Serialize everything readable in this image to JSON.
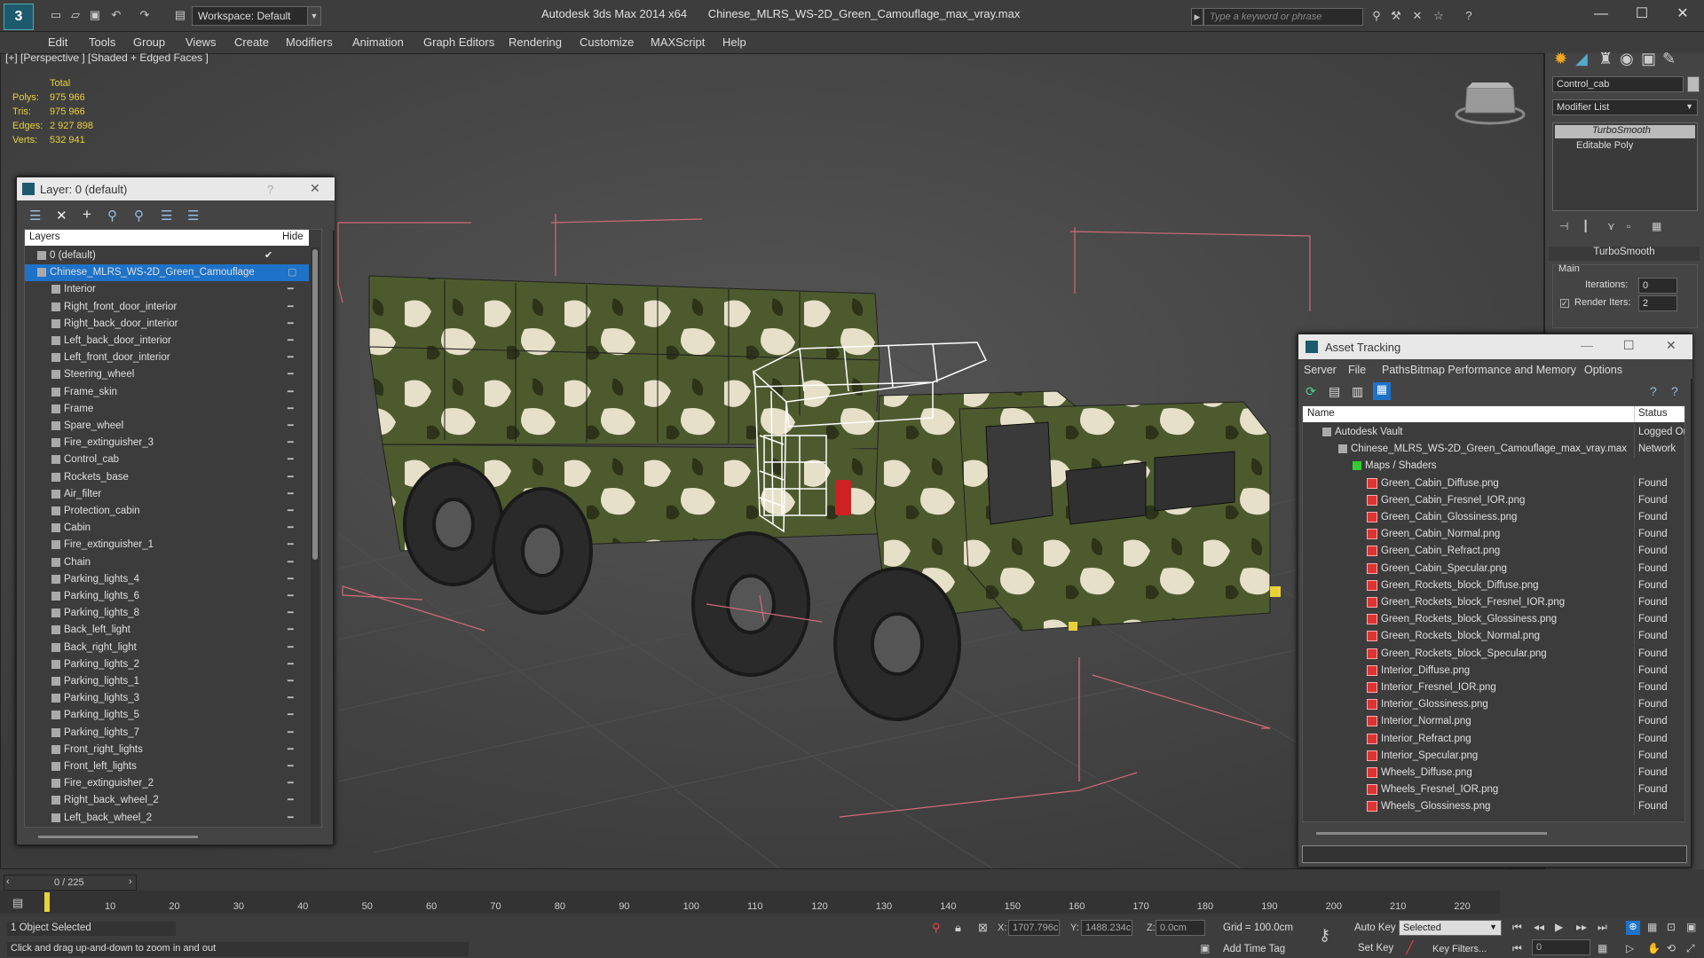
{
  "window": {
    "app_title": "Autodesk 3ds Max  2014 x64",
    "file_title": "Chinese_MLRS_WS-2D_Green_Camouflage_max_vray.max",
    "workspace": "Workspace: Default",
    "search_placeholder": "Type a keyword or phrase"
  },
  "menu": [
    "Edit",
    "Tools",
    "Group",
    "Views",
    "Create",
    "Modifiers",
    "Animation",
    "Graph Editors",
    "Rendering",
    "Customize",
    "MAXScript",
    "Help"
  ],
  "viewport": {
    "label": "[+] [Perspective ] [Shaded + Edged Faces ]",
    "stats": {
      "header": "Total",
      "polys_label": "Polys:",
      "polys": "975 966",
      "tris_label": "Tris:",
      "tris": "975 966",
      "edges_label": "Edges:",
      "edges": "2 927 898",
      "verts_label": "Verts:",
      "verts": "532 941"
    }
  },
  "layer_panel": {
    "title": "Layer: 0 (default)",
    "help": "?",
    "col_layers": "Layers",
    "col_hide": "Hide",
    "rows": [
      "0 (default)",
      "Chinese_MLRS_WS-2D_Green_Camouflage",
      "Interior",
      "Right_front_door_interior",
      "Right_back_door_interior",
      "Left_back_door_interior",
      "Left_front_door_interior",
      "Steering_wheel",
      "Frame_skin",
      "Frame",
      "Spare_wheel",
      "Fire_extinguisher_3",
      "Control_cab",
      "Rockets_base",
      "Air_filter",
      "Protection_cabin",
      "Cabin",
      "Fire_extinguisher_1",
      "Chain",
      "Parking_lights_4",
      "Parking_lights_6",
      "Parking_lights_8",
      "Back_left_light",
      "Back_right_light",
      "Parking_lights_2",
      "Parking_lights_1",
      "Parking_lights_3",
      "Parking_lights_5",
      "Parking_lights_7",
      "Front_right_lights",
      "Front_left_lights",
      "Fire_extinguisher_2",
      "Right_back_wheel_2",
      "Left_back_wheel_2"
    ]
  },
  "command_panel": {
    "object_name": "Control_cab",
    "modifier_list": "Modifier List",
    "stack": [
      "TurboSmooth",
      "Editable Poly"
    ],
    "rollout_title": "TurboSmooth",
    "group_main": "Main",
    "iterations_label": "Iterations:",
    "iterations_value": "0",
    "render_iters_label": "Render Iters:",
    "render_iters_value": "2"
  },
  "asset_panel": {
    "title": "Asset Tracking",
    "menu": [
      "Server",
      "File",
      "Paths",
      "Bitmap Performance and Memory",
      "Options"
    ],
    "col_name": "Name",
    "col_status": "Status",
    "rows": [
      {
        "name": "Autodesk Vault",
        "status": "Logged Out"
      },
      {
        "name": "Chinese_MLRS_WS-2D_Green_Camouflage_max_vray.max",
        "status": "Network"
      },
      {
        "name": "Maps / Shaders",
        "status": ""
      },
      {
        "name": "Green_Cabin_Diffuse.png",
        "status": "Found"
      },
      {
        "name": "Green_Cabin_Fresnel_IOR.png",
        "status": "Found"
      },
      {
        "name": "Green_Cabin_Glossiness.png",
        "status": "Found"
      },
      {
        "name": "Green_Cabin_Normal.png",
        "status": "Found"
      },
      {
        "name": "Green_Cabin_Refract.png",
        "status": "Found"
      },
      {
        "name": "Green_Cabin_Specular.png",
        "status": "Found"
      },
      {
        "name": "Green_Rockets_block_Diffuse.png",
        "status": "Found"
      },
      {
        "name": "Green_Rockets_block_Fresnel_IOR.png",
        "status": "Found"
      },
      {
        "name": "Green_Rockets_block_Glossiness.png",
        "status": "Found"
      },
      {
        "name": "Green_Rockets_block_Normal.png",
        "status": "Found"
      },
      {
        "name": "Green_Rockets_block_Specular.png",
        "status": "Found"
      },
      {
        "name": "Interior_Diffuse.png",
        "status": "Found"
      },
      {
        "name": "Interior_Fresnel_IOR.png",
        "status": "Found"
      },
      {
        "name": "Interior_Glossiness.png",
        "status": "Found"
      },
      {
        "name": "Interior_Normal.png",
        "status": "Found"
      },
      {
        "name": "Interior_Refract.png",
        "status": "Found"
      },
      {
        "name": "Interior_Specular.png",
        "status": "Found"
      },
      {
        "name": "Wheels_Diffuse.png",
        "status": "Found"
      },
      {
        "name": "Wheels_Fresnel_IOR.png",
        "status": "Found"
      },
      {
        "name": "Wheels_Glossiness.png",
        "status": "Found"
      }
    ]
  },
  "timeline": {
    "frame": "0 / 225",
    "ticks": [
      "10",
      "20",
      "30",
      "40",
      "50",
      "60",
      "70",
      "80",
      "90",
      "100",
      "110",
      "120",
      "130",
      "140",
      "150",
      "160",
      "170",
      "180",
      "190",
      "200",
      "210",
      "220"
    ]
  },
  "status": {
    "selected": "1 Object Selected",
    "hint": "Click and drag up-and-down to zoom in and out",
    "x_label": "X:",
    "x": "1707.796c",
    "y_label": "Y:",
    "y": "1488.234c",
    "z_label": "Z:",
    "z": "0.0cm",
    "grid": "Grid = 100.0cm",
    "auto_key": "Auto Key",
    "selected_dropdown": "Selected",
    "set_key": "Set Key",
    "key_filters": "Key Filters...",
    "add_time_tag": "Add Time Tag",
    "frame_field": "0"
  },
  "colors": {
    "selection": "#1e72c8",
    "stats": "#e8d23c",
    "bbox": "#d06a7a"
  }
}
